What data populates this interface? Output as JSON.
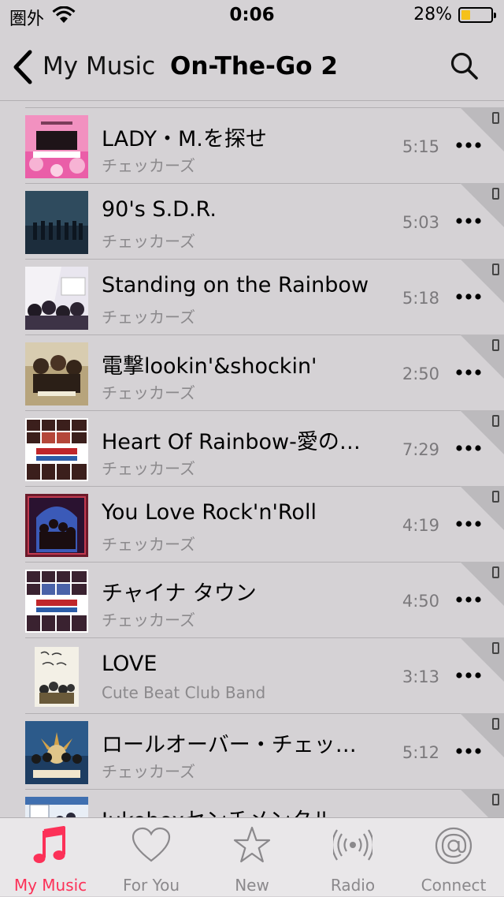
{
  "status_bar": {
    "carrier": "圏外",
    "time": "0:06",
    "battery": "28%"
  },
  "nav": {
    "back_label": "My Music",
    "title": "On-The-Go 2"
  },
  "songs": [
    {
      "title": "LADY・M.を探せ",
      "artist": "チェッカーズ",
      "duration": "5:15"
    },
    {
      "title": "90's S.D.R.",
      "artist": "チェッカーズ",
      "duration": "5:03"
    },
    {
      "title": "Standing on the Rainbow",
      "artist": "チェッカーズ",
      "duration": "5:18"
    },
    {
      "title": "電撃lookin'&shockin'",
      "artist": "チェッカーズ",
      "duration": "2:50"
    },
    {
      "title": "Heart Of Rainbow-愛の…",
      "artist": "チェッカーズ",
      "duration": "7:29"
    },
    {
      "title": "You Love Rock'n'Roll",
      "artist": "チェッカーズ",
      "duration": "4:19"
    },
    {
      "title": "チャイナ タウン",
      "artist": "チェッカーズ",
      "duration": "4:50"
    },
    {
      "title": "LOVE",
      "artist": "Cute Beat Club Band",
      "duration": "3:13"
    },
    {
      "title": "ロールオーバー・チェッ…",
      "artist": "チェッカーズ",
      "duration": "5:12"
    },
    {
      "title": "Jukeboxセンチメンタル",
      "artist": "",
      "duration": ""
    }
  ],
  "tabs": [
    {
      "label": "My Music",
      "icon": "music-note-icon"
    },
    {
      "label": "For You",
      "icon": "heart-icon"
    },
    {
      "label": "New",
      "icon": "star-icon"
    },
    {
      "label": "Radio",
      "icon": "radio-icon"
    },
    {
      "label": "Connect",
      "icon": "at-icon"
    }
  ],
  "colors": {
    "accent": "#fc3158",
    "background": "#d5d2d5",
    "tabbar": "#e9e7e9"
  }
}
